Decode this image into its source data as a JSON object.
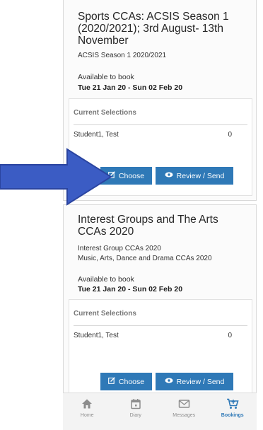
{
  "cards": [
    {
      "title": "Sports CCAs: ACSIS Season 1 (2020/2021); 3rd August- 13th November",
      "subtitle_lines": [
        "ACSIS Season 1 2020/2021"
      ],
      "available_label": "Available to book",
      "dates": "Tue 21 Jan 20 - Sun 02 Feb 20",
      "selections_heading": "Current Selections",
      "student": "Student1, Test",
      "count": "0",
      "choose_label": "Choose",
      "review_label": "Review / Send"
    },
    {
      "title": "Interest Groups and The Arts CCAs 2020",
      "subtitle_lines": [
        "Interest Group CCAs 2020",
        "Music, Arts, Dance and Drama CCAs 2020"
      ],
      "available_label": "Available to book",
      "dates": "Tue 21 Jan 20 - Sun 02 Feb 20",
      "selections_heading": "Current Selections",
      "student": "Student1, Test",
      "count": "0",
      "choose_label": "Choose",
      "review_label": "Review / Send"
    }
  ],
  "tabbar": {
    "tabs": [
      {
        "label": "Home",
        "icon": "home-icon",
        "active": false
      },
      {
        "label": "Diary",
        "icon": "calendar-icon",
        "active": false
      },
      {
        "label": "Messages",
        "icon": "envelope-icon",
        "active": false
      },
      {
        "label": "Bookings",
        "icon": "cart-icon",
        "active": true
      }
    ]
  },
  "annotation": {
    "icon": "arrow-right-icon",
    "color": "#3b5cc4"
  },
  "colors": {
    "accent": "#2f79b7",
    "tab_inactive": "#8d8d8d"
  }
}
